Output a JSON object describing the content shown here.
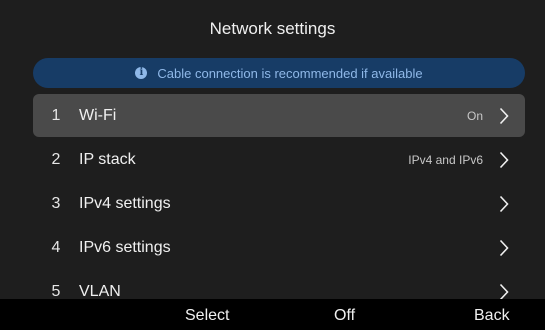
{
  "header": {
    "title": "Network settings"
  },
  "banner": {
    "icon": "info-icon",
    "text": "Cable connection is recommended if available"
  },
  "menu": {
    "items": [
      {
        "number": "1",
        "label": "Wi-Fi",
        "value": "On",
        "selected": true
      },
      {
        "number": "2",
        "label": "IP stack",
        "value": "IPv4 and IPv6",
        "selected": false
      },
      {
        "number": "3",
        "label": "IPv4 settings",
        "value": "",
        "selected": false
      },
      {
        "number": "4",
        "label": "IPv6 settings",
        "value": "",
        "selected": false
      },
      {
        "number": "5",
        "label": "VLAN",
        "value": "",
        "selected": false
      }
    ]
  },
  "softkeys": {
    "left": "Select",
    "middle": "Off",
    "right": "Back"
  },
  "colors": {
    "background": "#1e1e1e",
    "banner_bg": "#173c66",
    "banner_text": "#8fb8e8",
    "selected_row": "#4a4a4a",
    "softkey_bar": "#000000"
  }
}
